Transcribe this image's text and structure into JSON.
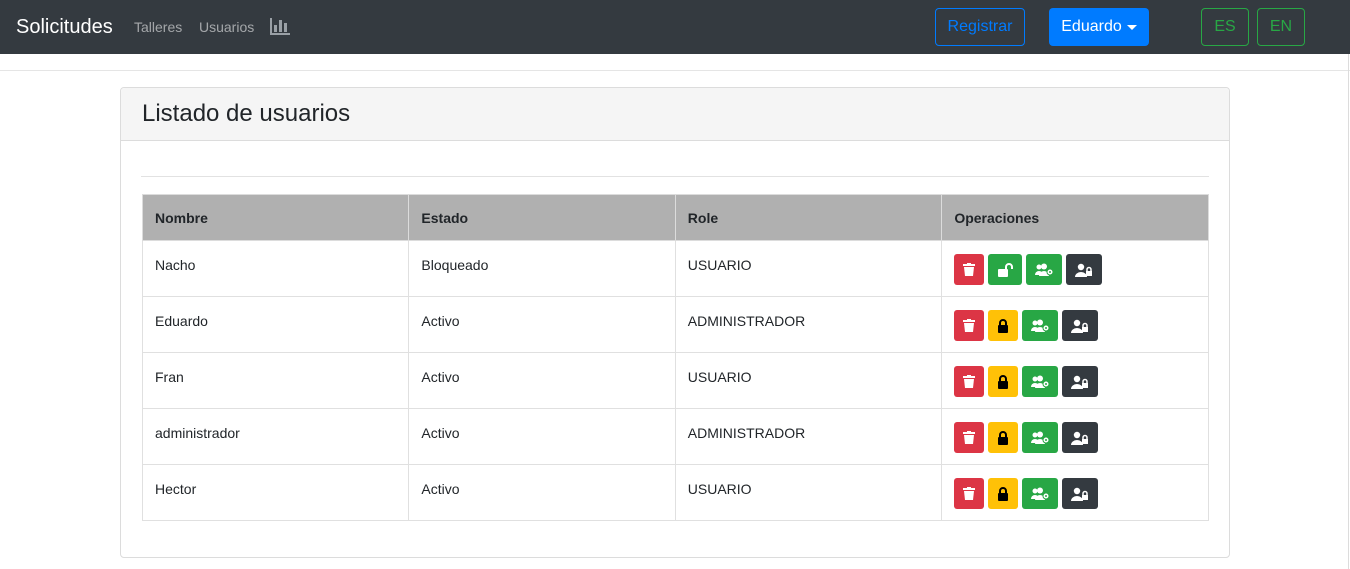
{
  "navbar": {
    "brand": "Solicitudes",
    "links": [
      "Talleres",
      "Usuarios"
    ],
    "chart_icon": "bar-chart-icon",
    "register_label": "Registrar",
    "user_label": "Eduardo",
    "lang_es": "ES",
    "lang_en": "EN"
  },
  "card": {
    "title": "Listado de usuarios"
  },
  "table": {
    "headers": [
      "Nombre",
      "Estado",
      "Role",
      "Operaciones"
    ],
    "rows": [
      {
        "nombre": "Nacho",
        "estado": "Bloqueado",
        "role": "USUARIO",
        "locked": true
      },
      {
        "nombre": "Eduardo",
        "estado": "Activo",
        "role": "ADMINISTRADOR",
        "locked": false
      },
      {
        "nombre": "Fran",
        "estado": "Activo",
        "role": "USUARIO",
        "locked": false
      },
      {
        "nombre": "administrador",
        "estado": "Activo",
        "role": "ADMINISTRADOR",
        "locked": false
      },
      {
        "nombre": "Hector",
        "estado": "Activo",
        "role": "USUARIO",
        "locked": false
      }
    ]
  },
  "icons": {
    "delete": "trash-icon",
    "lock": "lock-icon",
    "unlock": "unlock-icon",
    "role": "users-cog-icon",
    "admin": "user-lock-icon"
  },
  "colors": {
    "navbar": "#343a40",
    "primary": "#007bff",
    "success": "#28a745",
    "danger": "#dc3545",
    "warning": "#ffc107",
    "dark": "#343a40",
    "table_header": "#b0b0b0"
  }
}
